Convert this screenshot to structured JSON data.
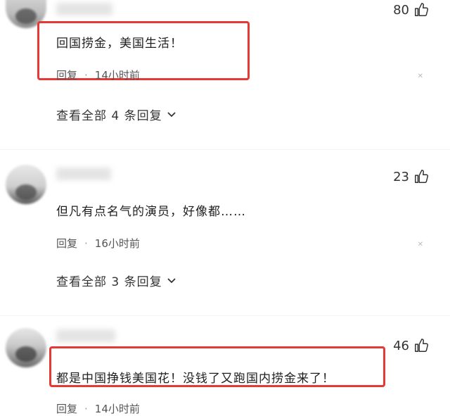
{
  "comments": [
    {
      "likes": "80",
      "text": "回国捞金，美国生活！",
      "reply_label": "回复",
      "time": "14小时前",
      "view_replies": "查看全部 4 条回复"
    },
    {
      "likes": "23",
      "text": "但凡有点名气的演员，好像都……",
      "reply_label": "回复",
      "time": "16小时前",
      "view_replies": "查看全部 3 条回复"
    },
    {
      "likes": "46",
      "text": "都是中国挣钱美国花！没钱了又跑国内捞金来了！",
      "reply_label": "回复",
      "time": "14小时前"
    }
  ],
  "icons": {
    "like": "thumbs-up-icon",
    "expand": "chevron-down-icon",
    "more": "close-icon"
  },
  "colors": {
    "highlight_border": "#e53935",
    "text": "#1f1f1f",
    "meta": "#555555"
  }
}
